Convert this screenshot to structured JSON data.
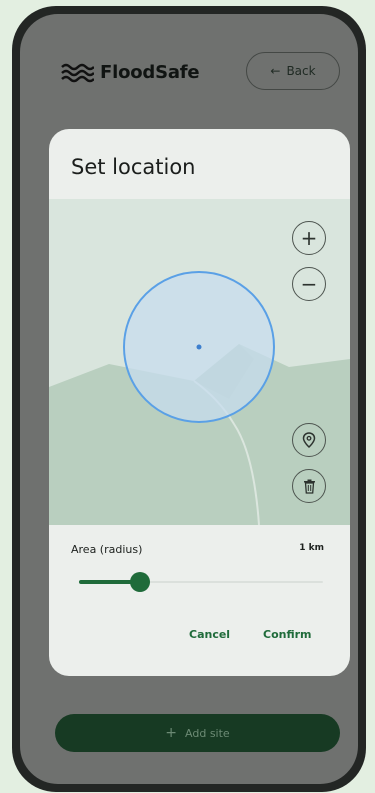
{
  "app": {
    "title": "FloodSafe",
    "back_label": "Back",
    "logo_icon": "waves-icon"
  },
  "dialog": {
    "title": "Set location",
    "map_controls": {
      "zoom_in": "+",
      "zoom_out": "−",
      "locate_icon": "location-pin-icon",
      "delete_icon": "trash-icon"
    },
    "radius_label": "Area (radius)",
    "radius_value": "1 km",
    "slider_value_fraction": 0.25,
    "cancel_label": "Cancel",
    "confirm_label": "Confirm"
  },
  "footer": {
    "add_site_label": "Add site",
    "add_icon": "+"
  },
  "colors": {
    "accent": "#1f6b3a",
    "primary_dark": "#173a23",
    "map_circle": "#5aa0e6",
    "terrain": "#b7cdbd",
    "screen_bg": "#6f716f"
  }
}
